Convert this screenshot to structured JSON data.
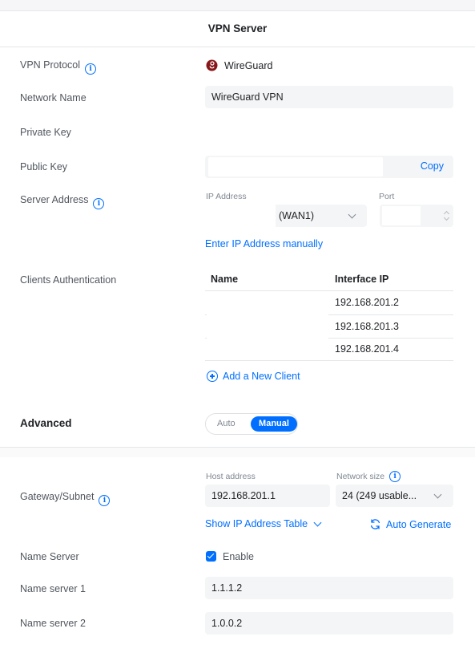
{
  "header": {
    "title": "VPN Server"
  },
  "vpn_protocol": {
    "label": "VPN Protocol",
    "value": "WireGuard",
    "icon": "wireguard-logo-icon"
  },
  "network_name": {
    "label": "Network Name",
    "value": "WireGuard VPN"
  },
  "private_key": {
    "label": "Private Key"
  },
  "public_key": {
    "label": "Public Key",
    "copy_label": "Copy"
  },
  "server_address": {
    "label": "Server Address",
    "ip_label": "IP Address",
    "ip_value": "(WAN1)",
    "port_label": "Port",
    "manual_link": "Enter IP Address manually"
  },
  "clients": {
    "label": "Clients Authentication",
    "columns": [
      "Name",
      "Interface IP"
    ],
    "rows": [
      {
        "name": "",
        "ip": "192.168.201.2"
      },
      {
        "name": "",
        "ip": "192.168.201.3"
      },
      {
        "name": "",
        "ip": "192.168.201.4"
      }
    ],
    "add_label": "Add a New Client"
  },
  "advanced": {
    "title": "Advanced",
    "mode_options": [
      "Auto",
      "Manual"
    ],
    "selected_mode": "Manual"
  },
  "gateway": {
    "label": "Gateway/Subnet",
    "host_label": "Host address",
    "host_value": "192.168.201.1",
    "size_label": "Network size",
    "size_value": "24 (249 usable...",
    "show_table": "Show IP Address Table",
    "auto_generate": "Auto Generate"
  },
  "name_server": {
    "label": "Name Server",
    "enable_label": "Enable",
    "enabled": true
  },
  "name_server_1": {
    "label": "Name server 1",
    "value": "1.1.1.2"
  },
  "name_server_2": {
    "label": "Name server 2",
    "value": "1.0.0.2"
  },
  "colors": {
    "accent": "#006fff",
    "field_bg": "#f4f5f6",
    "text": "#50565e",
    "logo": "#88171a"
  }
}
